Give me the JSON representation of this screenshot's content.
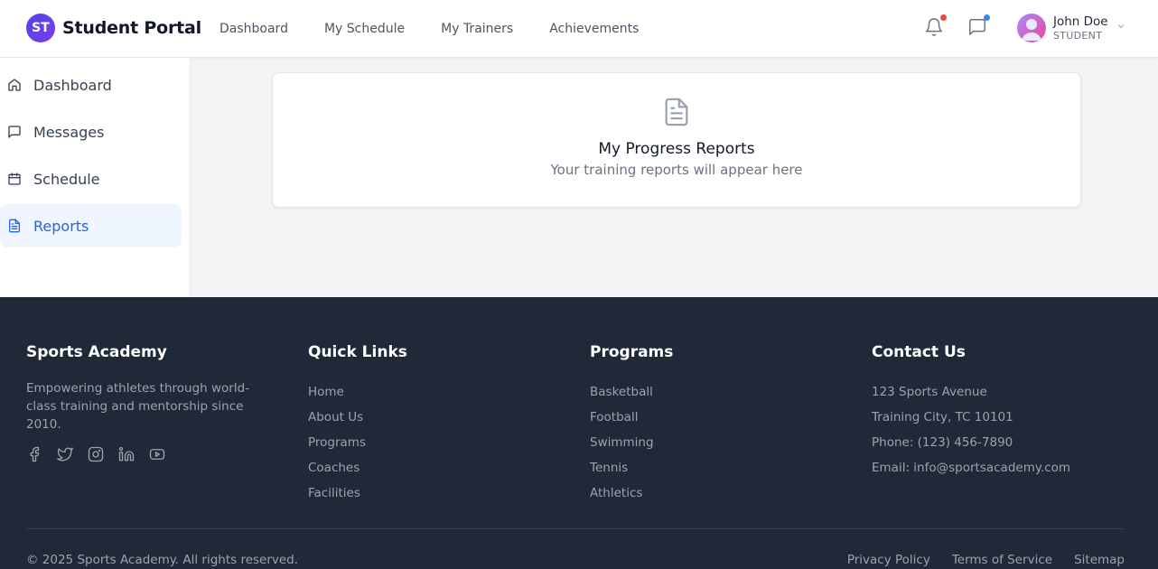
{
  "header": {
    "brand_badge": "ST",
    "brand_name": "Student Portal",
    "nav": [
      "Dashboard",
      "My Schedule",
      "My Trainers",
      "Achievements"
    ],
    "notification_dot_color": "#ef4444",
    "message_dot_color": "#3b82f6",
    "user": {
      "name": "John Doe",
      "role": "STUDENT"
    }
  },
  "sidebar": {
    "items": [
      {
        "label": "Dashboard",
        "icon": "home-icon"
      },
      {
        "label": "Messages",
        "icon": "message-icon"
      },
      {
        "label": "Schedule",
        "icon": "calendar-icon"
      },
      {
        "label": "Reports",
        "icon": "document-icon",
        "active": true
      }
    ]
  },
  "main": {
    "card_title": "My Progress Reports",
    "card_subtitle": "Your training reports will appear here"
  },
  "footer": {
    "about": {
      "title": "Sports Academy",
      "text": "Empowering athletes through world-class training and mentorship since 2010."
    },
    "quick_links": {
      "title": "Quick Links",
      "items": [
        "Home",
        "About Us",
        "Programs",
        "Coaches",
        "Facilities"
      ]
    },
    "programs": {
      "title": "Programs",
      "items": [
        "Basketball",
        "Football",
        "Swimming",
        "Tennis",
        "Athletics"
      ]
    },
    "contact": {
      "title": "Contact Us",
      "items": [
        "123 Sports Avenue",
        "Training City, TC 10101",
        "Phone: (123) 456-7890",
        "Email: info@sportsacademy.com"
      ]
    },
    "copyright": "© 2025 Sports Academy. All rights reserved.",
    "legal": [
      "Privacy Policy",
      "Terms of Service",
      "Sitemap"
    ]
  },
  "colors": {
    "accent": "#2563eb",
    "footer_bg": "#1f2937"
  }
}
